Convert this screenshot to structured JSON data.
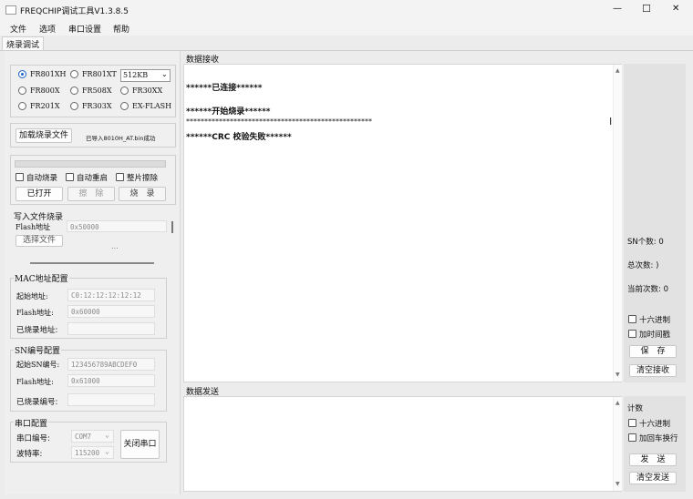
{
  "window": {
    "title": "FREQCHIP调试工具V1.3.8.5",
    "minimize_glyph": "—",
    "maximize_glyph": "☐",
    "close_glyph": "✕"
  },
  "menu": {
    "file": "文件",
    "options": "选项",
    "serial": "串口设置",
    "help": "帮助"
  },
  "tab": {
    "label": "烧录调试"
  },
  "chips": {
    "fr801xh": "FR801XH",
    "fr801xt": "FR801XT",
    "size_value": "512KB",
    "fr800x": "FR800X",
    "fr508x": "FR508X",
    "fr30xx": "FR30XX",
    "fr201x": "FR201X",
    "fr303x": "FR303X",
    "exflash": "EX-FLASH"
  },
  "load": {
    "button": "加载烧录文件",
    "status": "已导入8010H_AT.bin成功"
  },
  "options": {
    "auto_burn": "自动烧录",
    "auto_restart": "自动重启",
    "full_erase": "整片擦除",
    "opened": "已打开",
    "erase": "擦　除",
    "burn": "烧　录"
  },
  "write_file": {
    "title": "写入文件烧录",
    "flash_label": "Flash地址",
    "flash_value": "0x50000",
    "choose": "选择文件",
    "dots": "..."
  },
  "mac": {
    "title": "MAC地址配置",
    "start_label": "起始地址:",
    "start_value": "C0:12:12:12:12:12",
    "flash_label": "Flash地址:",
    "flash_value": "0x60000",
    "burned_label": "已烧录地址:",
    "burned_value": ""
  },
  "sn": {
    "title": "SN编号配置",
    "start_label": "起始SN编号:",
    "start_value": "123456789ABCDEF0",
    "flash_label": "Flash地址:",
    "flash_value": "0x61000",
    "burned_label": "已烧录编号:",
    "burned_value": ""
  },
  "serial_cfg": {
    "title": "串口配置",
    "port_label": "串口编号:",
    "port_value": "COM7",
    "baud_label": "波特率:",
    "baud_value": "115200",
    "close_button": "关闭串口"
  },
  "receive": {
    "title": "数据接收",
    "lines": [
      "******已连接******",
      "",
      "******开始烧录******",
      "***************************************************",
      "******CRC 校验失败******"
    ],
    "sn_count": "SN个数: 0",
    "total_count": "总次数: )",
    "current_count": "当前次数: 0",
    "hex": "十六进制",
    "timestamp": "加时间戳",
    "save": "保　存",
    "clear": "清空接收"
  },
  "send": {
    "title": "数据发送",
    "count": "计数",
    "hex": "十六进制",
    "crlf": "加回车换行",
    "send": "发　送",
    "clear": "清空发送"
  },
  "colors": {
    "accent": "#1d63c9",
    "panel": "#e2e2e2"
  }
}
